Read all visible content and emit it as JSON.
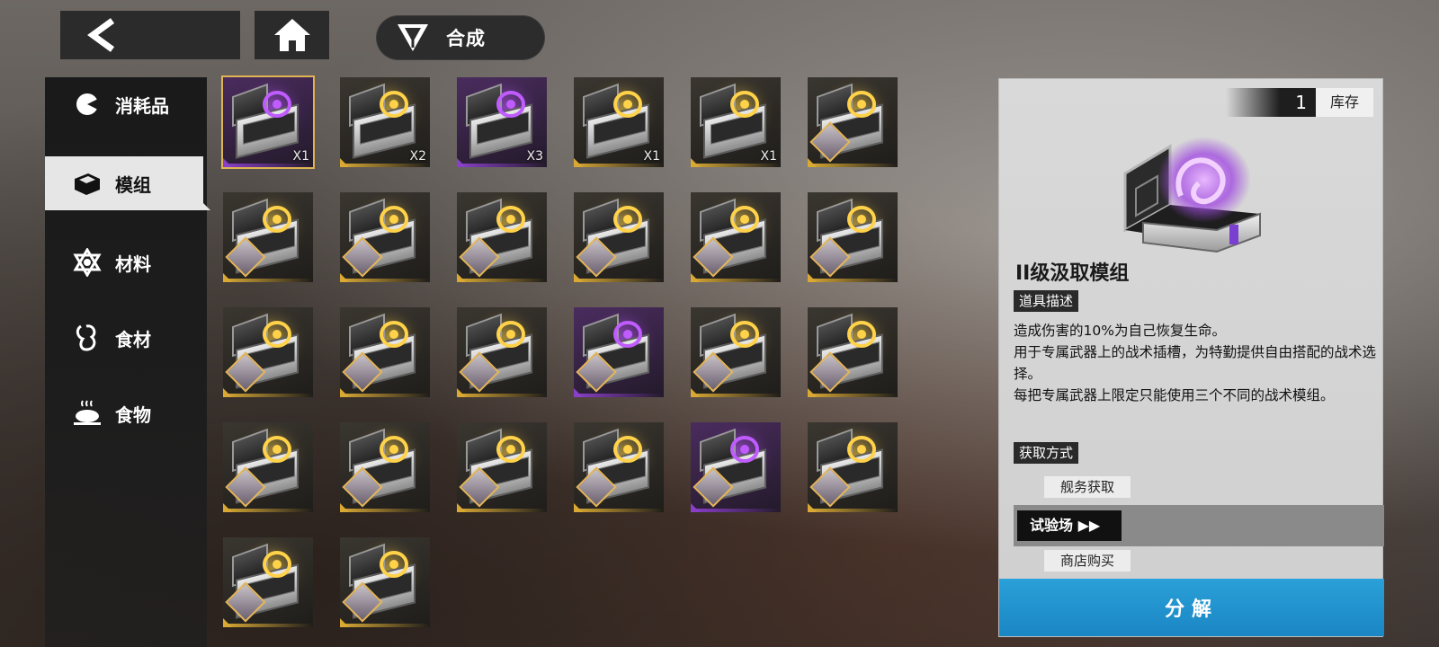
{
  "header": {
    "back_icon": "chevron-left-icon",
    "home_icon": "home-icon",
    "title_icon": "triangle-emblem-icon",
    "title": "合成"
  },
  "sidebar": {
    "items": [
      {
        "label": "消耗品",
        "icon": "consumable-icon",
        "active": false
      },
      {
        "label": "模组",
        "icon": "module-box-icon",
        "active": true
      },
      {
        "label": "材料",
        "icon": "material-icon",
        "active": false
      },
      {
        "label": "食材",
        "icon": "ingredient-icon",
        "active": false
      },
      {
        "label": "食物",
        "icon": "food-icon",
        "active": false
      }
    ]
  },
  "grid": {
    "items": [
      {
        "rarity": "purple",
        "qty": "X1",
        "portrait": false,
        "selected": true
      },
      {
        "rarity": "gold",
        "qty": "X2",
        "portrait": false
      },
      {
        "rarity": "purple",
        "qty": "X3",
        "portrait": false
      },
      {
        "rarity": "gold",
        "qty": "X1",
        "portrait": false
      },
      {
        "rarity": "gold",
        "qty": "X1",
        "portrait": false
      },
      {
        "rarity": "gold",
        "qty": "",
        "portrait": true
      },
      {
        "rarity": "gold",
        "qty": "",
        "portrait": true
      },
      {
        "rarity": "gold",
        "qty": "",
        "portrait": true
      },
      {
        "rarity": "gold",
        "qty": "",
        "portrait": true
      },
      {
        "rarity": "gold",
        "qty": "",
        "portrait": true
      },
      {
        "rarity": "gold",
        "qty": "",
        "portrait": true
      },
      {
        "rarity": "gold",
        "qty": "",
        "portrait": true
      },
      {
        "rarity": "gold",
        "qty": "",
        "portrait": true
      },
      {
        "rarity": "gold",
        "qty": "",
        "portrait": true
      },
      {
        "rarity": "gold",
        "qty": "",
        "portrait": true
      },
      {
        "rarity": "purple",
        "qty": "",
        "portrait": true
      },
      {
        "rarity": "gold",
        "qty": "",
        "portrait": true
      },
      {
        "rarity": "gold",
        "qty": "",
        "portrait": true
      },
      {
        "rarity": "gold",
        "qty": "",
        "portrait": true
      },
      {
        "rarity": "gold",
        "qty": "",
        "portrait": true
      },
      {
        "rarity": "gold",
        "qty": "",
        "portrait": true
      },
      {
        "rarity": "gold",
        "qty": "",
        "portrait": true
      },
      {
        "rarity": "purple",
        "qty": "",
        "portrait": true
      },
      {
        "rarity": "gold",
        "qty": "",
        "portrait": true
      },
      {
        "rarity": "gold",
        "qty": "",
        "portrait": true
      },
      {
        "rarity": "gold",
        "qty": "",
        "portrait": true
      }
    ]
  },
  "detail": {
    "stock_count": "1",
    "stock_label": "库存",
    "item_name": "II级汲取模组",
    "desc_tag": "道具描述",
    "desc_lines": [
      "造成伤害的10%为自己恢复生命。",
      "用于专属武器上的战术插槽，为特勤提供自由搭配的战术选择。",
      "每把专属武器上限定只能使用三个不同的战术模组。"
    ],
    "source_tag": "获取方式",
    "sources": [
      "舰务获取",
      "商店购买"
    ],
    "trial_button": "试验场 ▶▶",
    "decompose_button": "分解"
  },
  "colors": {
    "gold": "#d9a934",
    "purple": "#8a3fc8",
    "decompose": "#1a90cc"
  }
}
